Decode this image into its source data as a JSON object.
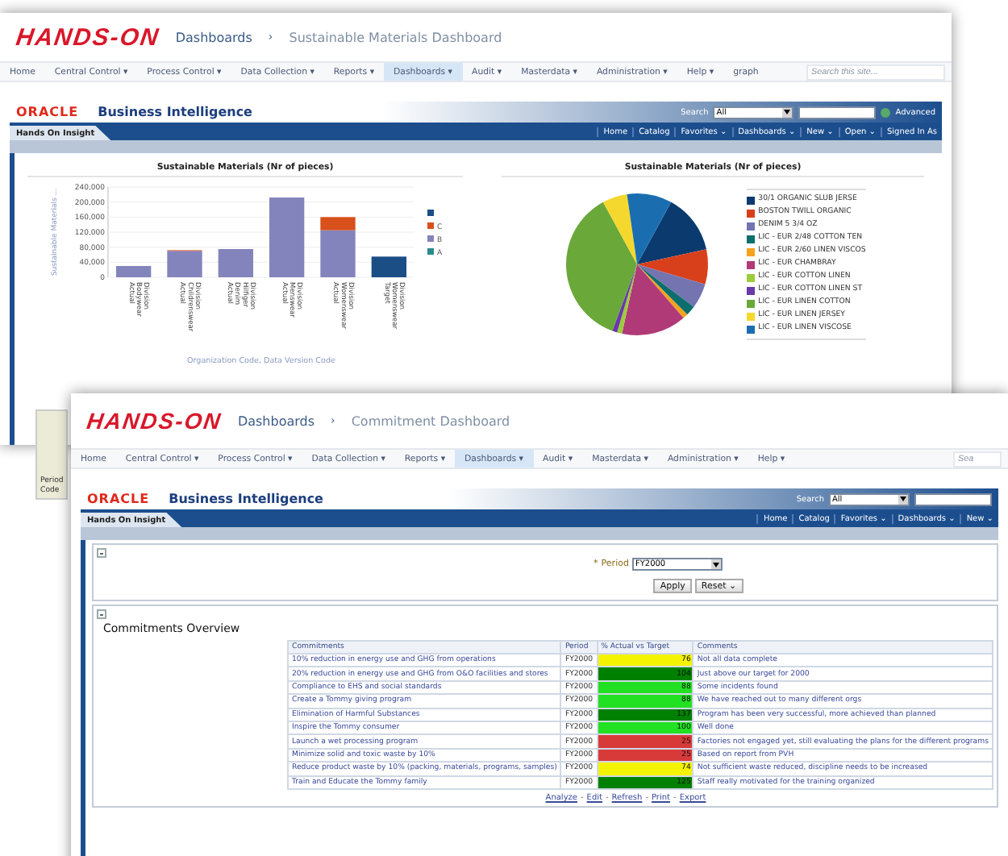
{
  "back_window": {
    "logo": "HANDS-ON",
    "breadcrumb": {
      "parent": "Dashboards",
      "separator": "›",
      "current": "Sustainable Materials Dashboard"
    },
    "nav": [
      {
        "label": "Home",
        "selected": false
      },
      {
        "label": "Central Control ▾",
        "selected": false
      },
      {
        "label": "Process Control ▾",
        "selected": false
      },
      {
        "label": "Data Collection ▾",
        "selected": false
      },
      {
        "label": "Reports ▾",
        "selected": false
      },
      {
        "label": "Dashboards ▾",
        "selected": true
      },
      {
        "label": "Audit ▾",
        "selected": false
      },
      {
        "label": "Masterdata ▾",
        "selected": false
      },
      {
        "label": "Administration ▾",
        "selected": false
      },
      {
        "label": "Help ▾",
        "selected": false
      },
      {
        "label": "graph",
        "selected": false
      }
    ],
    "site_search": {
      "placeholder": "Search this site..."
    },
    "obi": {
      "oracle": "ORACLE",
      "product": "Business Intelligence",
      "search_label": "Search",
      "search_scope": "All",
      "advanced": "Advanced",
      "tab": "Hands On Insight",
      "links": [
        "Home",
        "Catalog",
        "Favorites ⌄",
        "Dashboards ⌄",
        "New ⌄",
        "Open ⌄",
        "Signed In As"
      ]
    },
    "bar_chart": {
      "chart_data": {
        "type": "bar",
        "title": "Sustainable Materials (Nr of pieces)",
        "grid": true,
        "legend": true,
        "xlabel": "Organization Code, Data Version Code",
        "ylabel": "Sustainable Materials ...",
        "stacked": true,
        "categories": [
          "Division Bodywear Actual",
          "Division Childrenswear Actual",
          "Division Hilfiger Denim Actual",
          "Division Menswear Actual",
          "Division Womenswear Actual",
          "Division Womenswear Target"
        ],
        "series": [
          {
            "name": "A",
            "color": "#2a8a8a",
            "values": [
              null,
              null,
              null,
              null,
              null,
              null
            ]
          },
          {
            "name": "B",
            "color": "#8484bc",
            "values": [
              30000,
              70000,
              75000,
              212000,
              125000,
              null
            ]
          },
          {
            "name": "C",
            "color": "#d8501c",
            "values": [
              null,
              2000,
              null,
              null,
              35000,
              null
            ]
          },
          {
            "color": "#1c4e86",
            "values": [
              null,
              null,
              null,
              null,
              null,
              55000
            ]
          }
        ],
        "ylim": [
          0,
          240000
        ],
        "yticks": [
          {
            "value": 0,
            "label": "0"
          },
          {
            "value": 40000,
            "label": "40,000"
          },
          {
            "value": 80000,
            "label": "80,000"
          },
          {
            "value": 120000,
            "label": "120,000"
          },
          {
            "value": 160000,
            "label": "160,000"
          },
          {
            "value": 200000,
            "label": "200,000"
          },
          {
            "value": 240000,
            "label": "240,000"
          }
        ]
      }
    },
    "pie_chart": {
      "title": "Sustainable Materials (Nr of pieces)",
      "legend": [
        {
          "label": "30/1 ORGANIC SLUB JERSE",
          "color": "#0b3a6e"
        },
        {
          "label": "BOSTON TWILL ORGANIC",
          "color": "#d8401c"
        },
        {
          "label": "DENIM 5 3/4 OZ",
          "color": "#7474b0"
        },
        {
          "label": "LIC - EUR 2/48 COTTON TEN",
          "color": "#0d6e6e"
        },
        {
          "label": "LIC - EUR 2/60 LINEN VISCOS",
          "color": "#f5a21e"
        },
        {
          "label": "LIC - EUR CHAMBRAY",
          "color": "#b03a78"
        },
        {
          "label": "LIC - EUR COTTON LINEN",
          "color": "#9ccc3c"
        },
        {
          "label": "LIC - EUR COTTON LINEN ST",
          "color": "#6a3aa8"
        },
        {
          "label": "LIC - EUR LINEN COTTON",
          "color": "#6aa83a"
        },
        {
          "label": "LIC - EUR LINEN JERSEY",
          "color": "#f5d82e"
        },
        {
          "label": "LIC - EUR LINEN VISCOSE",
          "color": "#1a6eb0"
        }
      ]
    },
    "side_label": "Period Code"
  },
  "front_window": {
    "logo": "HANDS-ON",
    "breadcrumb": {
      "parent": "Dashboards",
      "separator": "›",
      "current": "Commitment Dashboard"
    },
    "nav": [
      {
        "label": "Home",
        "selected": false
      },
      {
        "label": "Central Control ▾",
        "selected": false
      },
      {
        "label": "Process Control ▾",
        "selected": false
      },
      {
        "label": "Data Collection ▾",
        "selected": false
      },
      {
        "label": "Reports ▾",
        "selected": false
      },
      {
        "label": "Dashboards ▾",
        "selected": true
      },
      {
        "label": "Audit ▾",
        "selected": false
      },
      {
        "label": "Masterdata ▾",
        "selected": false
      },
      {
        "label": "Administration ▾",
        "selected": false
      },
      {
        "label": "Help ▾",
        "selected": false
      }
    ],
    "site_search": {
      "placeholder": "Sea"
    },
    "obi": {
      "oracle": "ORACLE",
      "product": "Business Intelligence",
      "search_label": "Search",
      "search_scope": "All",
      "tab": "Hands On Insight",
      "links": [
        "Home",
        "Catalog",
        "Favorites ⌄",
        "Dashboards ⌄",
        "New ⌄"
      ]
    },
    "prompt": {
      "label": "Period",
      "required_mark": "*",
      "value": "FY2000",
      "apply": "Apply",
      "reset": "Reset ⌄"
    },
    "section_title": "Commitments Overview",
    "table": {
      "columns": [
        "Commitments",
        "Period",
        "% Actual vs Target",
        "Comments"
      ],
      "rows": [
        {
          "commitment": "10% reduction in energy use and GHG from operations",
          "period": "FY2000",
          "value": "76",
          "color": "#f4f400",
          "comment": "Not all data complete"
        },
        {
          "commitment": "20% reduction in energy use and GHG from O&O facilities and stores",
          "period": "FY2000",
          "value": "104",
          "color": "#008000",
          "comment": "Just above our target for 2000"
        },
        {
          "commitment": "Compliance to EHS and social standards",
          "period": "FY2000",
          "value": "88",
          "color": "#22e022",
          "comment": "Some incidents found"
        },
        {
          "commitment": "Create a Tommy giving program",
          "period": "FY2000",
          "value": "88",
          "color": "#22e022",
          "comment": "We have reached out to many different orgs"
        },
        {
          "commitment": "Elimination of Harmful Substances",
          "period": "FY2000",
          "value": "137",
          "color": "#008000",
          "comment": "Program has been very successful, more achieved than planned"
        },
        {
          "commitment": "Inspire the Tommy consumer",
          "period": "FY2000",
          "value": "100",
          "color": "#22e022",
          "comment": "Well done"
        },
        {
          "commitment": "Launch a wet processing program",
          "period": "FY2000",
          "value": "25",
          "color": "#d83a3a",
          "comment": "Factories not engaged yet, still evaluating the plans for the different programs"
        },
        {
          "commitment": "Minimize solid and toxic waste by 10%",
          "period": "FY2000",
          "value": "25",
          "color": "#d83a3a",
          "comment": "Based on report from PVH"
        },
        {
          "commitment": "Reduce product waste by 10% (packing, materials, programs, samples)",
          "period": "FY2000",
          "value": "74",
          "color": "#f4f400",
          "comment": "Not sufficient waste reduced, discipline needs to be increased"
        },
        {
          "commitment": "Train and Educate the Tommy family",
          "period": "FY2000",
          "value": "125",
          "color": "#008000",
          "comment": "Staff really motivated for the training organized"
        }
      ]
    },
    "footer_links": [
      "Analyze",
      "Edit",
      "Refresh",
      "Print",
      "Export"
    ],
    "footer_separator": "-"
  }
}
